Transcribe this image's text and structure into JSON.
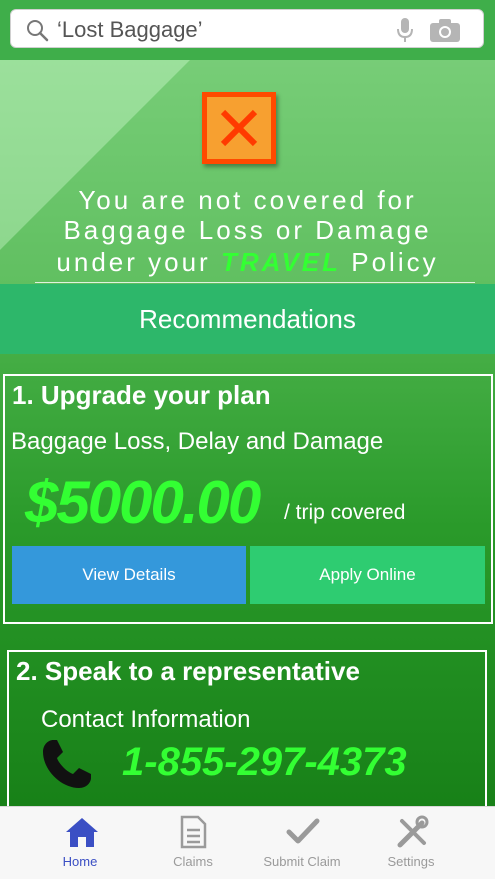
{
  "search": {
    "query": "‘Lost Baggage’",
    "icons": [
      "search-icon",
      "microphone-icon",
      "camera-icon"
    ]
  },
  "alert": {
    "icon": "close-x-icon",
    "line1": "You are not covered for",
    "line2": "Baggage Loss or Damage",
    "line3_prefix": "under your ",
    "line3_highlight": "TRAVEL",
    "line3_suffix": " Policy"
  },
  "recommendations": {
    "title": "Recommendations"
  },
  "option1": {
    "title": "1.   Upgrade your plan",
    "subtitle": "Baggage Loss, Delay and Damage",
    "amount": "$5000.00",
    "amount_suffix": "/ trip covered",
    "view_details_label": "View Details",
    "apply_online_label": "Apply Online"
  },
  "option2": {
    "title": "2.   Speak to a representative",
    "contact_label": "Contact Information",
    "phone": "1-855-297-4373"
  },
  "tabs": [
    {
      "label": "Home",
      "icon": "home-icon",
      "active": true
    },
    {
      "label": "Claims",
      "icon": "document-icon",
      "active": false
    },
    {
      "label": "Submit Claim",
      "icon": "checkmark-icon",
      "active": false
    },
    {
      "label": "Settings",
      "icon": "tools-icon",
      "active": false
    }
  ],
  "colors": {
    "accent_green": "#33ff33",
    "alert_orange": "#ff4a00",
    "view_button": "#3498db",
    "apply_button": "#2ecc71",
    "active_tab": "#3b4fc4"
  }
}
